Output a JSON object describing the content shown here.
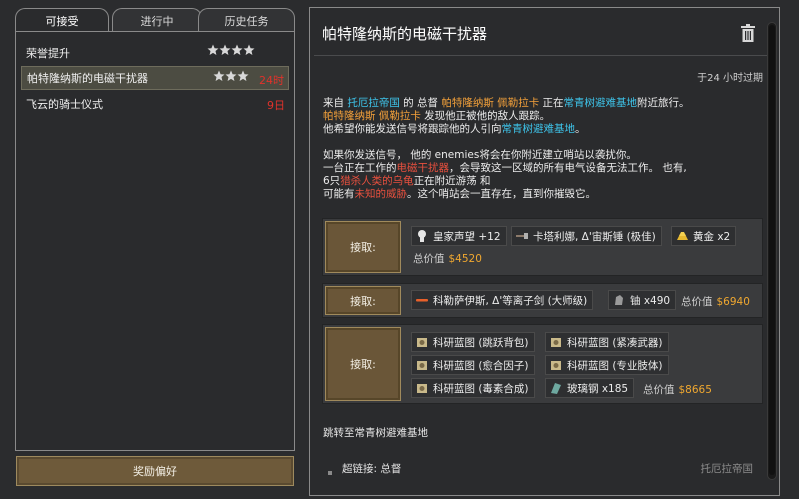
{
  "tabs": [
    {
      "label": "可接受",
      "active": true
    },
    {
      "label": "进行中",
      "active": false
    },
    {
      "label": "历史任务",
      "active": false
    }
  ],
  "quests": [
    {
      "name": "荣誉提升",
      "stars": 4,
      "time": "",
      "selected": false
    },
    {
      "name": "帕特隆纳斯的电磁干扰器",
      "stars": 3,
      "time": "24时",
      "selected": true
    },
    {
      "name": "飞云的骑士仪式",
      "stars": 0,
      "time": "9日",
      "selected": false
    }
  ],
  "bottom_button": "奖励偏好",
  "detail": {
    "title": "帕特隆纳斯的电磁干扰器",
    "expire": "于24 小时过期",
    "desc": {
      "l1_a": "来自 ",
      "l1_faction": "托厄拉帝国",
      "l1_b": " 的 总督 ",
      "l1_person": "帕特隆纳斯 佩勒拉卡",
      "l1_c": " 正在",
      "l1_place": "常青树避难基地",
      "l1_d": "附近旅行。",
      "l2_person": "帕特隆纳斯 佩勒拉卡",
      "l2_b": " 发现他正被他的敌人跟踪。",
      "l3_a": "他希望你能发送信号将跟踪他的人引向",
      "l3_place": "常青树避难基地",
      "l3_b": "。",
      "l4": "如果你发送信号， 他的 enemies将会在你附近建立哨站以袭扰你。",
      "l5_a": "一台正在工作的",
      "l5_item": "电磁干扰器",
      "l5_b": "，会导致这一区域的所有电气设备无法工作。 也有,",
      "l6_a": "6只",
      "l6_red": "猎杀人类的乌龟",
      "l6_b": "正在附近游荡 和",
      "l7_a": "可能有",
      "l7_red": "未知的威胁",
      "l7_b": "。这个哨站会一直存在，直到你摧毁它。"
    },
    "rewards": [
      {
        "accept": "接取:",
        "items": [
          {
            "icon": "goodwill-icon",
            "text": "皇家声望 +12"
          },
          {
            "icon": "warhammer-icon",
            "text": "卡塔利娜, Δ'宙斯锤 (极佳)"
          },
          {
            "icon": "gold-icon",
            "text": "黄金 x2"
          }
        ],
        "total_label": "总价值",
        "total_value": "$4520"
      },
      {
        "accept": "接取:",
        "items": [
          {
            "icon": "sword-icon",
            "text": "科勒萨伊斯, Δ'等离子剑 (大师级)"
          },
          {
            "icon": "uranium-icon",
            "text": "铀 x490"
          }
        ],
        "total_label": "总价值",
        "total_value": "$6940"
      },
      {
        "accept": "接取:",
        "items": [
          {
            "icon": "blueprint-icon",
            "text": "科研蓝图 (跳跃背包)"
          },
          {
            "icon": "blueprint-icon",
            "text": "科研蓝图 (紧凑武器)"
          },
          {
            "icon": "blueprint-icon",
            "text": "科研蓝图 (愈合因子)"
          },
          {
            "icon": "blueprint-icon",
            "text": "科研蓝图 (专业肢体)"
          },
          {
            "icon": "blueprint-icon",
            "text": "科研蓝图 (毒素合成)"
          },
          {
            "icon": "glass-steel-icon",
            "text": "玻璃钢 x185"
          }
        ],
        "total_label": "总价值",
        "total_value": "$8665"
      }
    ],
    "goto": "跳转至常青树避难基地",
    "footer_link": "超链接: 总督",
    "footer_faction": "托厄拉帝国"
  },
  "colors": {
    "accent_cyan": "#3ec4ea",
    "accent_orange": "#f2a03a",
    "threat_red": "#e8503e",
    "value_gold": "#f0a830",
    "button_brown": "#6a5638"
  }
}
